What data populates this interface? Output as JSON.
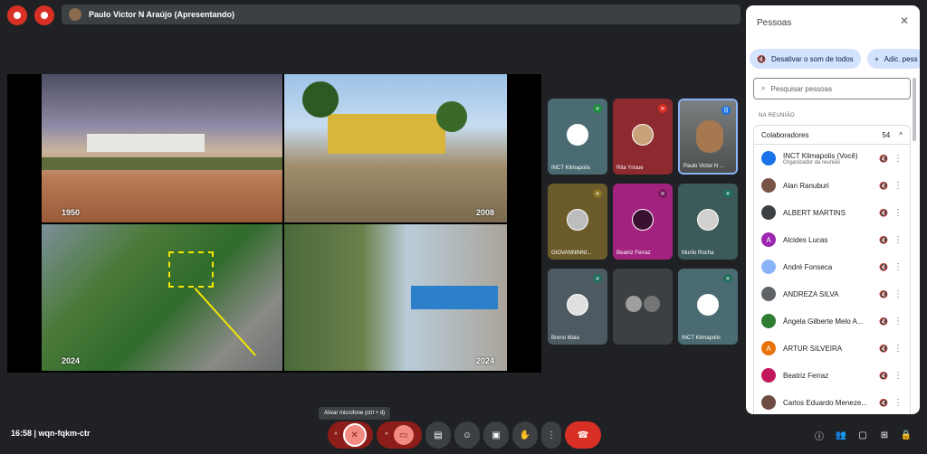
{
  "top": {
    "presenter": "Paulo Victor N Araújo (Apresentando)"
  },
  "stage": {
    "photos": [
      {
        "year": "1950"
      },
      {
        "year": "2008"
      },
      {
        "year": "2024"
      },
      {
        "year": "2024"
      }
    ]
  },
  "tiles": [
    {
      "name": "INCT Klimapolis",
      "mic": "muted",
      "bg": "#4a6b72"
    },
    {
      "name": "Rita Ynoue",
      "mic": "muted-red",
      "bg": "#8c2a2f"
    },
    {
      "name": "Paulo Victor N ...",
      "mic": "active",
      "bg": "#5f6368"
    },
    {
      "name": "GIOVANNINNI...",
      "mic": "muted",
      "bg": "#6b5a2a"
    },
    {
      "name": "Beatriz Ferraz",
      "mic": "muted",
      "bg": "#a1237f"
    },
    {
      "name": "Murilo Rocha",
      "mic": "muted",
      "bg": "#3d5a5a"
    },
    {
      "name": "Breno Maia",
      "mic": "muted",
      "bg": "#4d5a61"
    },
    {
      "name": "",
      "mic": "none",
      "bg": "#3c4043"
    },
    {
      "name": "INCT Klimapolis",
      "mic": "muted",
      "bg": "#4a6b72"
    }
  ],
  "panel": {
    "title": "Pessoas",
    "mute_all": "Desativar o som de todos",
    "add_people": "Adic. pess",
    "search_placeholder": "Pesquisar pessoas",
    "section": "NA REUNIÃO",
    "collab_label": "Colaboradores",
    "collab_count": "54",
    "people": [
      {
        "name": "INCT Klimapolis (Você)",
        "sub": "Organizador da reunião",
        "color": "#1a73e8",
        "initial": ""
      },
      {
        "name": "Alan Ranuburi",
        "sub": "",
        "color": "#795548",
        "initial": ""
      },
      {
        "name": "ALBERT MARTINS",
        "sub": "",
        "color": "#3c4043",
        "initial": ""
      },
      {
        "name": "Alcides Lucas",
        "sub": "",
        "color": "#9c27b0",
        "initial": "A"
      },
      {
        "name": "André Fonseca",
        "sub": "",
        "color": "#8ab4f8",
        "initial": ""
      },
      {
        "name": "ANDREZA SILVA",
        "sub": "",
        "color": "#5f6368",
        "initial": ""
      },
      {
        "name": "Ângela Gilberte Melo A...",
        "sub": "",
        "color": "#2e7d32",
        "initial": ""
      },
      {
        "name": "ARTUR SILVEIRA",
        "sub": "",
        "color": "#e8710a",
        "initial": "A"
      },
      {
        "name": "Beatriz Ferraz",
        "sub": "",
        "color": "#c2185b",
        "initial": ""
      },
      {
        "name": "Carlos Eduardo Meneze...",
        "sub": "",
        "color": "#6d4c41",
        "initial": ""
      }
    ]
  },
  "bottom": {
    "time": "16:58  |  wqn-fqkm-ctr",
    "tooltip": "Ativar microfone (ctrl + d)"
  }
}
